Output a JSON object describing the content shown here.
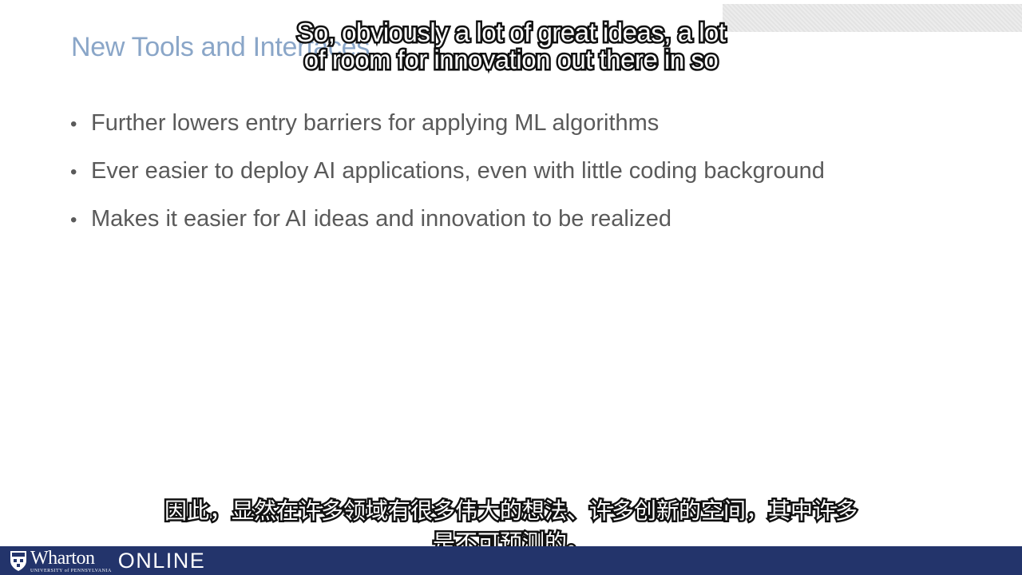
{
  "slide": {
    "title": "New Tools and Interfaces",
    "bullet_marker": "•",
    "bullets": [
      "Further lowers entry barriers for applying ML algorithms",
      "Ever easier to deploy AI applications, even with little coding background",
      "Makes it easier for AI ideas and innovation to be realized"
    ]
  },
  "captions": {
    "english": [
      "So, obviously a lot of great ideas, a lot",
      "of room for innovation out there in so"
    ],
    "chinese": [
      "因此，显然在许多领域有很多伟大的想法、许多创新的空间，其中许多",
      "是不可预测的。"
    ]
  },
  "footer": {
    "logo_icon": "shield-icon",
    "brand": "Wharton",
    "university": "UNIVERSITY of PENNSYLVANIA",
    "product": "ONLINE",
    "bar_color": "#23346b"
  },
  "colors": {
    "title": "#8aa6c8",
    "body_text": "#5a5a5a"
  }
}
